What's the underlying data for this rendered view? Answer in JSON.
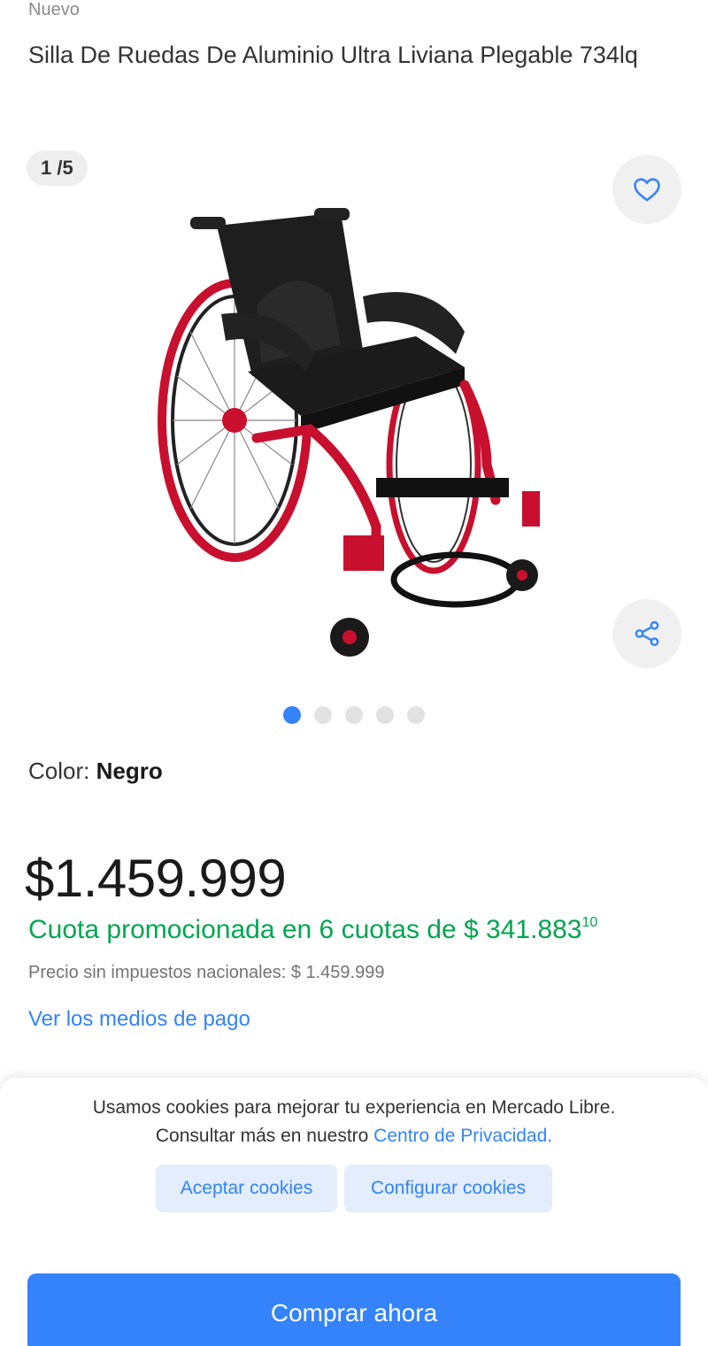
{
  "product": {
    "condition": "Nuevo",
    "title": "Silla De Ruedas De Aluminio Ultra Liviana Plegable 734lq"
  },
  "gallery": {
    "counter": "1 /5",
    "total_images": 5,
    "active_index": 0
  },
  "variant": {
    "label": "Color: ",
    "value": "Negro"
  },
  "pricing": {
    "price": "$1.459.999",
    "installments_text": "Cuota promocionada en 6 cuotas de $ 341.883",
    "installments_cents": "10",
    "tax_note": "Precio sin impuestos nacionales: $ 1.459.999",
    "payment_methods_link": "Ver los medios de pago"
  },
  "cookies": {
    "line1": "Usamos cookies para mejorar tu experiencia en Mercado Libre.",
    "line2_prefix": "Consultar más en nuestro ",
    "privacy_link": "Centro de Privacidad.",
    "accept_label": "Aceptar cookies",
    "configure_label": "Configurar cookies"
  },
  "actions": {
    "buy_now_label": "Comprar ahora"
  },
  "colors": {
    "accent_blue": "#3483fa",
    "installments_green": "#00a650"
  },
  "icons": {
    "favorite": "heart-icon",
    "share": "share-icon"
  }
}
